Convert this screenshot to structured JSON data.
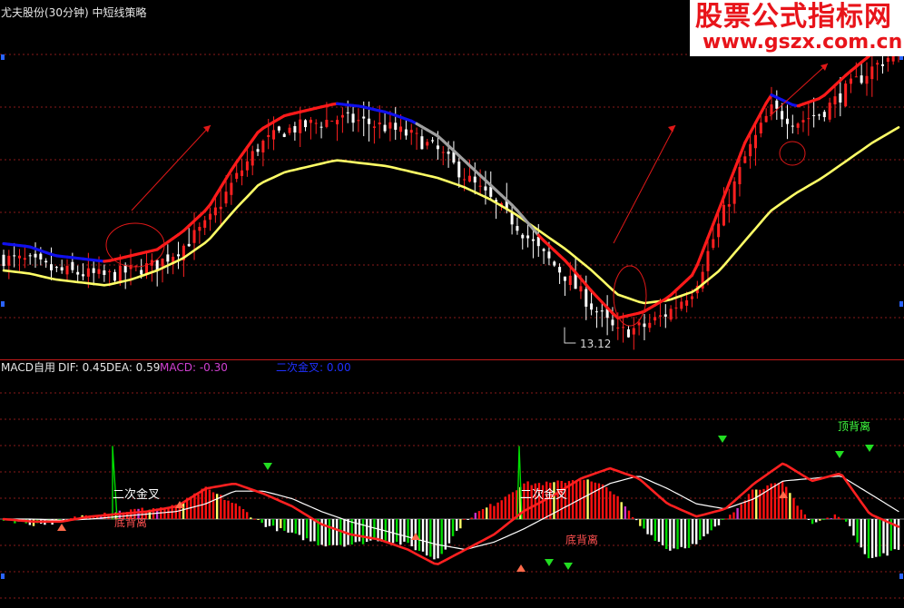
{
  "window": {
    "title": "尤夫股份(30分钟) 中短线策略"
  },
  "watermark": {
    "line1": "股票公式指标网",
    "line2": "www.gszx.com.cn"
  },
  "indicator": {
    "name": "MACD自用",
    "dif": "DIF: 0.45",
    "dea": "DEA: 0.59",
    "macd": "MACD: -0.30",
    "signal": "二次金叉: 0.00"
  },
  "labels": {
    "low_price": "13.12",
    "second_cross_1": "二次金叉",
    "second_cross_2": "二次金叉",
    "bottom_div_1": "底背离",
    "bottom_div_2": "底背离",
    "top_div": "顶背离"
  },
  "colors": {
    "background": "#000000",
    "up_candle": "#ff2020",
    "down_candle": "#ffffff",
    "grid": "#8a1a1a",
    "ma_gray": "#a0a0a0",
    "ma_yellow": "#ffff66",
    "trend_red": "#ff1a1a",
    "trend_blue": "#1010ee",
    "dif_line": "#ffffff",
    "dea_line": "#ff2020",
    "bar_red": "#ff1010",
    "bar_yellow": "#ffff66",
    "bar_magenta": "#cc33cc",
    "bar_green": "#00dd00",
    "bar_white": "#ffffff"
  },
  "chart_data": [
    {
      "type": "line",
      "panel": "price",
      "title": "尤夫股份(30分钟) 中短线策略",
      "x_unit": "30-minute bars",
      "y_unit": "price",
      "annotations": [
        "13.12"
      ],
      "series": [
        {
          "values": [
            1.0,
            0.9,
            0.6,
            0.5,
            0.4,
            0.6,
            0.8,
            1.4,
            2.2,
            3.6,
            4.8,
            5.3,
            5.5,
            5.7,
            5.6,
            5.4,
            5.1,
            4.6,
            3.8,
            3.0,
            2.2,
            1.2,
            0.4,
            -0.6,
            -1.5,
            -1.3,
            -0.8,
            0.0,
            2.2,
            4.4,
            6.0,
            5.6,
            5.9,
            6.7,
            7.4,
            8.0
          ]
        },
        {
          "values": [
            0.6,
            0.5,
            0.3,
            0.2,
            0.1,
            0.3,
            0.6,
            1.0,
            1.6,
            2.6,
            3.5,
            3.9,
            4.1,
            4.3,
            4.2,
            4.1,
            3.9,
            3.7,
            3.4,
            3.0,
            2.5,
            1.9,
            1.3,
            0.6,
            -0.2,
            -0.5,
            -0.4,
            -0.1,
            0.6,
            1.6,
            2.6,
            3.2,
            3.7,
            4.3,
            4.9,
            5.4
          ]
        }
      ]
    },
    {
      "type": "bar",
      "panel": "MACD",
      "title": "MACD自用",
      "annotations": [
        "二次金叉",
        "二次金叉",
        "底背离",
        "底背离",
        "顶背离"
      ],
      "series": [
        {
          "name": "DIF",
          "values": [
            0.0,
            -0.1,
            -0.1,
            0.1,
            0.2,
            0.3,
            0.5,
            1.2,
            1.4,
            1.0,
            0.5,
            -0.2,
            -0.6,
            -0.8,
            -1.2,
            -1.8,
            -1.2,
            -0.6,
            0.3,
            0.9,
            1.6,
            2.0,
            1.6,
            0.6,
            0.1,
            0.4,
            1.4,
            2.2,
            1.5,
            1.8,
            0.2,
            -0.3
          ]
        },
        {
          "name": "DEA",
          "values": [
            0.0,
            0.0,
            -0.05,
            0.0,
            0.1,
            0.2,
            0.3,
            0.6,
            1.1,
            1.1,
            0.8,
            0.3,
            -0.1,
            -0.4,
            -0.7,
            -1.0,
            -1.2,
            -0.9,
            -0.4,
            0.2,
            0.8,
            1.4,
            1.7,
            1.2,
            0.6,
            0.4,
            0.8,
            1.5,
            1.6,
            1.7,
            1.0,
            0.3
          ]
        },
        {
          "name": "MACD",
          "values": [
            0.0,
            -0.2,
            -0.1,
            0.2,
            0.3,
            0.4,
            0.5,
            1.2,
            0.6,
            -0.2,
            -0.6,
            -1.0,
            -1.0,
            -0.8,
            -1.0,
            -1.6,
            0.0,
            0.6,
            1.4,
            1.4,
            1.6,
            1.2,
            -0.2,
            -1.2,
            -1.0,
            0.0,
            1.2,
            1.4,
            -0.2,
            0.2,
            -1.6,
            -1.2
          ]
        }
      ]
    }
  ]
}
